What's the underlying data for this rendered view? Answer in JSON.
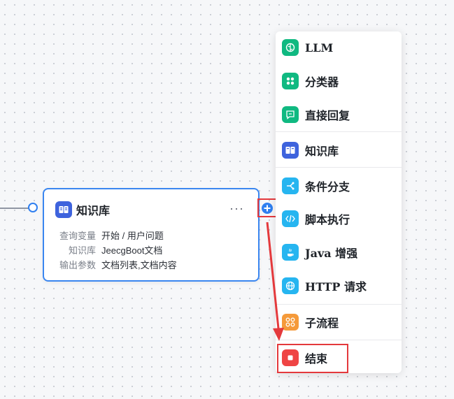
{
  "node": {
    "title": "知识库",
    "more": "···",
    "rows": [
      {
        "label": "查询变量",
        "value": "开始 / 用户问题"
      },
      {
        "label": "知识库",
        "value": "JeecgBoot文档"
      },
      {
        "label": "输出参数",
        "value": "文档列表,文档内容"
      }
    ]
  },
  "menu": {
    "items": [
      {
        "label": "LLM",
        "icon": "brain-icon",
        "color": "#10b981"
      },
      {
        "label": "分类器",
        "icon": "grid-icon",
        "color": "#10b981"
      },
      {
        "label": "直接回复",
        "icon": "reply-icon",
        "color": "#10b981"
      },
      {
        "label": "知识库",
        "icon": "book-icon",
        "color": "#3e63dd"
      },
      {
        "label": "条件分支",
        "icon": "branch-icon",
        "color": "#26b5f0"
      },
      {
        "label": "脚本执行",
        "icon": "code-icon",
        "color": "#26b5f0"
      },
      {
        "label": "Java 增强",
        "icon": "java-icon",
        "color": "#26b5f0"
      },
      {
        "label": "HTTP 请求",
        "icon": "globe-icon",
        "color": "#26b5f0"
      },
      {
        "label": "子流程",
        "icon": "subflow-icon",
        "color": "#f59a3a"
      },
      {
        "label": "结束",
        "icon": "stop-icon",
        "color": "#ef4444"
      }
    ]
  }
}
